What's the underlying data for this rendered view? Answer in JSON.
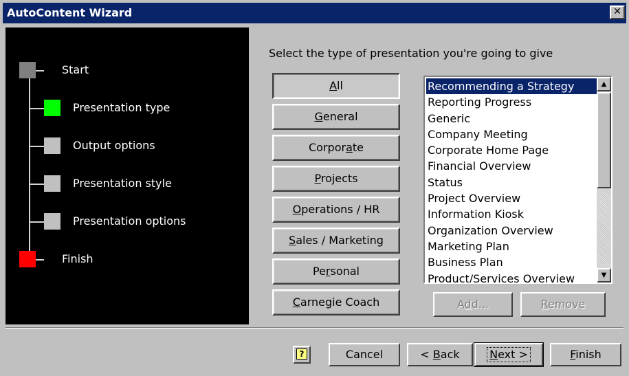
{
  "window": {
    "title": "AutoContent Wizard",
    "close_glyph": "✕"
  },
  "steps": [
    {
      "label": "Start",
      "color": "#808080"
    },
    {
      "label": "Presentation type",
      "color": "#00ff00"
    },
    {
      "label": "Output options",
      "color": "#c0c0c0"
    },
    {
      "label": "Presentation style",
      "color": "#c0c0c0"
    },
    {
      "label": "Presentation options",
      "color": "#c0c0c0"
    },
    {
      "label": "Finish",
      "color": "#ff0000"
    }
  ],
  "prompt": "Select the type of presentation you're going to give",
  "categories": [
    {
      "pre": "",
      "key": "A",
      "post": "ll",
      "pressed": true
    },
    {
      "pre": "",
      "key": "G",
      "post": "eneral"
    },
    {
      "pre": "Corpor",
      "key": "a",
      "post": "te"
    },
    {
      "pre": "",
      "key": "P",
      "post": "rojects"
    },
    {
      "pre": "",
      "key": "O",
      "post": "perations / HR"
    },
    {
      "pre": "",
      "key": "S",
      "post": "ales / Marketing"
    },
    {
      "pre": "Pe",
      "key": "r",
      "post": "sonal"
    },
    {
      "pre": "",
      "key": "C",
      "post": "arnegie Coach"
    }
  ],
  "presentations": [
    "Recommending a Strategy",
    "Reporting Progress",
    "Generic",
    "Company Meeting",
    "Corporate Home Page",
    "Financial Overview",
    "Status",
    "Project Overview",
    "Information Kiosk",
    "Organization Overview",
    "Marketing Plan",
    "Business Plan",
    "Product/Services Overview"
  ],
  "selected_presentation": "Recommending a Strategy",
  "list_buttons": {
    "add": {
      "pre": "A",
      "key": "d",
      "post": "d..."
    },
    "remove": {
      "pre": "",
      "key": "R",
      "post": "emove"
    }
  },
  "footer": {
    "help_glyph": "?",
    "cancel": "Cancel",
    "back": {
      "pre": "< ",
      "key": "B",
      "post": "ack"
    },
    "next": {
      "pre": "",
      "key": "N",
      "post": "ext >"
    },
    "finish": {
      "pre": "",
      "key": "F",
      "post": "inish"
    }
  }
}
